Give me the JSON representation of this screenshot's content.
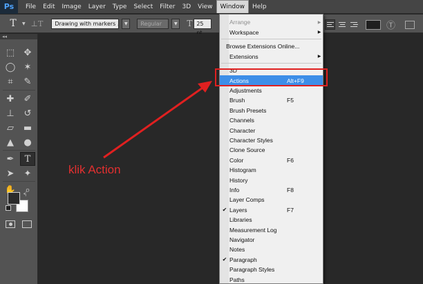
{
  "app": {
    "logo": "Ps"
  },
  "menubar": {
    "items": [
      "File",
      "Edit",
      "Image",
      "Layer",
      "Type",
      "Select",
      "Filter",
      "3D",
      "View",
      "Window",
      "Help"
    ],
    "active": "Window"
  },
  "options": {
    "font_family": "Drawing with markers ...",
    "font_style": "Regular",
    "font_size": "25 pt"
  },
  "window_menu": {
    "items": [
      {
        "label": "Arrange",
        "shortcut": "",
        "submenu": true,
        "disabled": true,
        "checked": false
      },
      {
        "label": "Workspace",
        "shortcut": "",
        "submenu": true,
        "disabled": false,
        "checked": false
      },
      {
        "label": "Browse Extensions Online...",
        "shortcut": "",
        "submenu": false,
        "disabled": false,
        "checked": false
      },
      {
        "label": "Extensions",
        "shortcut": "",
        "submenu": true,
        "disabled": false,
        "checked": false
      },
      {
        "label": "3D",
        "shortcut": "",
        "submenu": false,
        "disabled": false,
        "checked": false
      },
      {
        "label": "Actions",
        "shortcut": "Alt+F9",
        "submenu": false,
        "disabled": false,
        "checked": false,
        "highlighted": true
      },
      {
        "label": "Adjustments",
        "shortcut": "",
        "submenu": false,
        "disabled": false,
        "checked": false
      },
      {
        "label": "Brush",
        "shortcut": "F5",
        "submenu": false,
        "disabled": false,
        "checked": false
      },
      {
        "label": "Brush Presets",
        "shortcut": "",
        "submenu": false,
        "disabled": false,
        "checked": false
      },
      {
        "label": "Channels",
        "shortcut": "",
        "submenu": false,
        "disabled": false,
        "checked": false
      },
      {
        "label": "Character",
        "shortcut": "",
        "submenu": false,
        "disabled": false,
        "checked": false
      },
      {
        "label": "Character Styles",
        "shortcut": "",
        "submenu": false,
        "disabled": false,
        "checked": false
      },
      {
        "label": "Clone Source",
        "shortcut": "",
        "submenu": false,
        "disabled": false,
        "checked": false
      },
      {
        "label": "Color",
        "shortcut": "F6",
        "submenu": false,
        "disabled": false,
        "checked": false
      },
      {
        "label": "Histogram",
        "shortcut": "",
        "submenu": false,
        "disabled": false,
        "checked": false
      },
      {
        "label": "History",
        "shortcut": "",
        "submenu": false,
        "disabled": false,
        "checked": false
      },
      {
        "label": "Info",
        "shortcut": "F8",
        "submenu": false,
        "disabled": false,
        "checked": false
      },
      {
        "label": "Layer Comps",
        "shortcut": "",
        "submenu": false,
        "disabled": false,
        "checked": false
      },
      {
        "label": "Layers",
        "shortcut": "F7",
        "submenu": false,
        "disabled": false,
        "checked": true
      },
      {
        "label": "Libraries",
        "shortcut": "",
        "submenu": false,
        "disabled": false,
        "checked": false
      },
      {
        "label": "Measurement Log",
        "shortcut": "",
        "submenu": false,
        "disabled": false,
        "checked": false
      },
      {
        "label": "Navigator",
        "shortcut": "",
        "submenu": false,
        "disabled": false,
        "checked": false
      },
      {
        "label": "Notes",
        "shortcut": "",
        "submenu": false,
        "disabled": false,
        "checked": false
      },
      {
        "label": "Paragraph",
        "shortcut": "",
        "submenu": false,
        "disabled": false,
        "checked": true
      },
      {
        "label": "Paragraph Styles",
        "shortcut": "",
        "submenu": false,
        "disabled": false,
        "checked": false
      },
      {
        "label": "Paths",
        "shortcut": "",
        "submenu": false,
        "disabled": false,
        "checked": false
      }
    ]
  },
  "annotation": {
    "text": "klik Action"
  },
  "colors": {
    "highlight": "#3d8ee8",
    "annotation_red": "#e02020",
    "panel": "#535353",
    "workspace": "#282828"
  },
  "icons": {
    "tool_icons": [
      "move-icon",
      "marquee-icon",
      "lasso-icon",
      "magic-wand-icon",
      "crop-icon",
      "eyedropper-icon",
      "healing-icon",
      "brush-icon",
      "stamp-icon",
      "history-brush-icon",
      "eraser-icon",
      "gradient-icon",
      "blur-icon",
      "dodge-icon",
      "pen-icon",
      "type-icon",
      "path-select-icon",
      "shape-icon",
      "hand-icon",
      "zoom-icon"
    ]
  }
}
